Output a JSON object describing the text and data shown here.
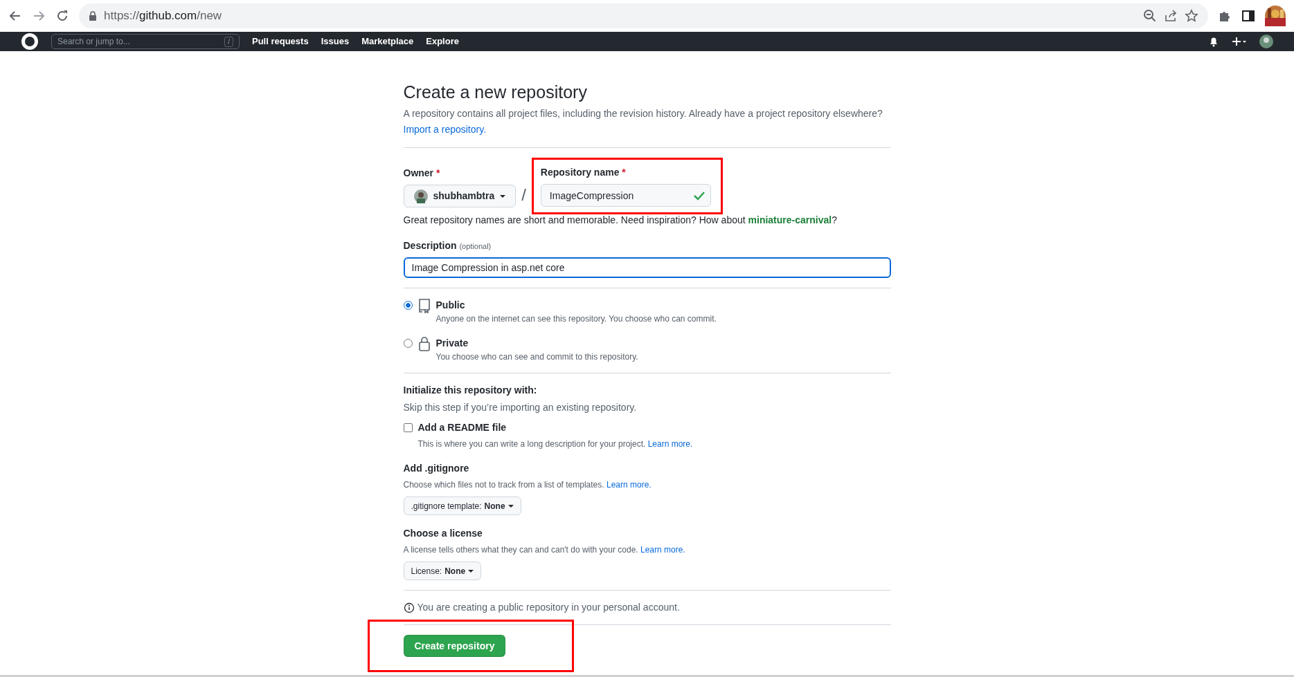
{
  "browser": {
    "url_scheme": "https://",
    "url_host": "github.com",
    "url_path": "/new"
  },
  "header": {
    "search_placeholder": "Search or jump to...",
    "search_key": "/",
    "nav": [
      "Pull requests",
      "Issues",
      "Marketplace",
      "Explore"
    ]
  },
  "page": {
    "title": "Create a new repository",
    "intro": "A repository contains all project files, including the revision history. Already have a project repository elsewhere?",
    "import_link": "Import a repository."
  },
  "owner": {
    "label": "Owner",
    "required": "*",
    "value": "shubhambtra"
  },
  "separator": "/",
  "repo_name": {
    "label": "Repository name",
    "required": "*",
    "value": "ImageCompression",
    "valid": true,
    "highlighted": true
  },
  "name_hint": {
    "text": "Great repository names are short and memorable. Need inspiration? How about",
    "suggestion": "miniature-carnival",
    "end": "?"
  },
  "description": {
    "label": "Description",
    "note": "(optional)",
    "value": "Image Compression in asp.net core",
    "focused": true
  },
  "visibility": [
    {
      "kind": "public",
      "title": "Public",
      "text": "Anyone on the internet can see this repository. You choose who can commit.",
      "selected": true
    },
    {
      "kind": "private",
      "title": "Private",
      "text": "You choose who can see and commit to this repository.",
      "selected": false
    }
  ],
  "initialize": {
    "heading": "Initialize this repository with:",
    "text": "Skip this step if you’re importing an existing repository."
  },
  "readme": {
    "label": "Add a README file",
    "checked": false,
    "note": "This is where you can write a long description for your project.",
    "link": "Learn more."
  },
  "options": [
    {
      "heading": "Add .gitignore",
      "note": "Choose which files not to track from a list of templates.",
      "link": "Learn more.",
      "dropdown_label": ".gitignore template:",
      "dropdown_value": "None"
    },
    {
      "heading": "Choose a license",
      "note": "A license tells others what they can and can't do with your code.",
      "link": "Learn more.",
      "dropdown_label": "License:",
      "dropdown_value": "None"
    }
  ],
  "info_text": "You are creating a public repository in your personal account.",
  "submit": {
    "label": "Create repository",
    "highlighted": true
  }
}
